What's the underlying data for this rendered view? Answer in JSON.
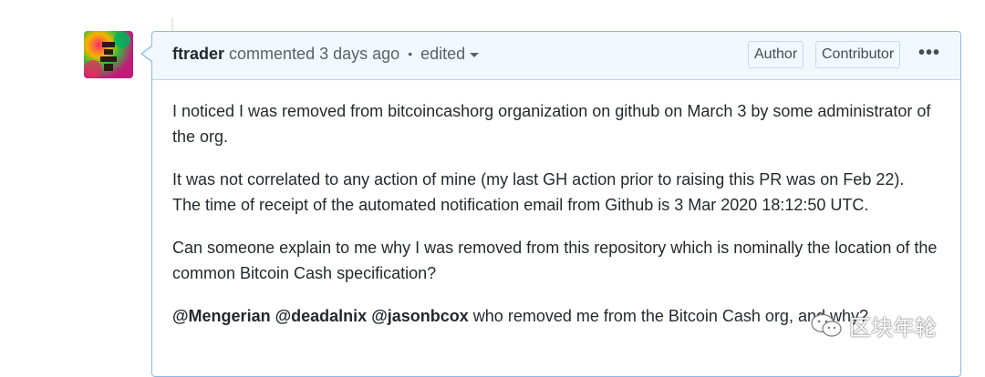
{
  "comment": {
    "author": "ftrader",
    "action": "commented",
    "time": "3 days ago",
    "separator": "•",
    "edited": "edited",
    "badges": {
      "author": "Author",
      "contributor": "Contributor"
    },
    "more": "•••",
    "paragraphs": {
      "p1": "I noticed I was removed from bitcoincashorg organization on github on March 3 by some administrator of the org.",
      "p2a": "It was not correlated to any action of mine (my last GH action prior to raising this PR was on Feb 22).",
      "p2b": "The time of receipt of the automated notification email from Github is 3 Mar 2020 18:12:50 UTC.",
      "p3": "Can someone explain to me why I was removed from this repository which is nominally the location of the common Bitcoin Cash specification?",
      "mention1": "@Mengerian",
      "mention2": "@deadalnix",
      "mention3": "@jasonbcox",
      "p4_rest": "who removed me from the Bitcoin Cash org, and why?"
    }
  },
  "watermark": {
    "text": "区块年轮",
    "icon": "wechat-icon"
  }
}
